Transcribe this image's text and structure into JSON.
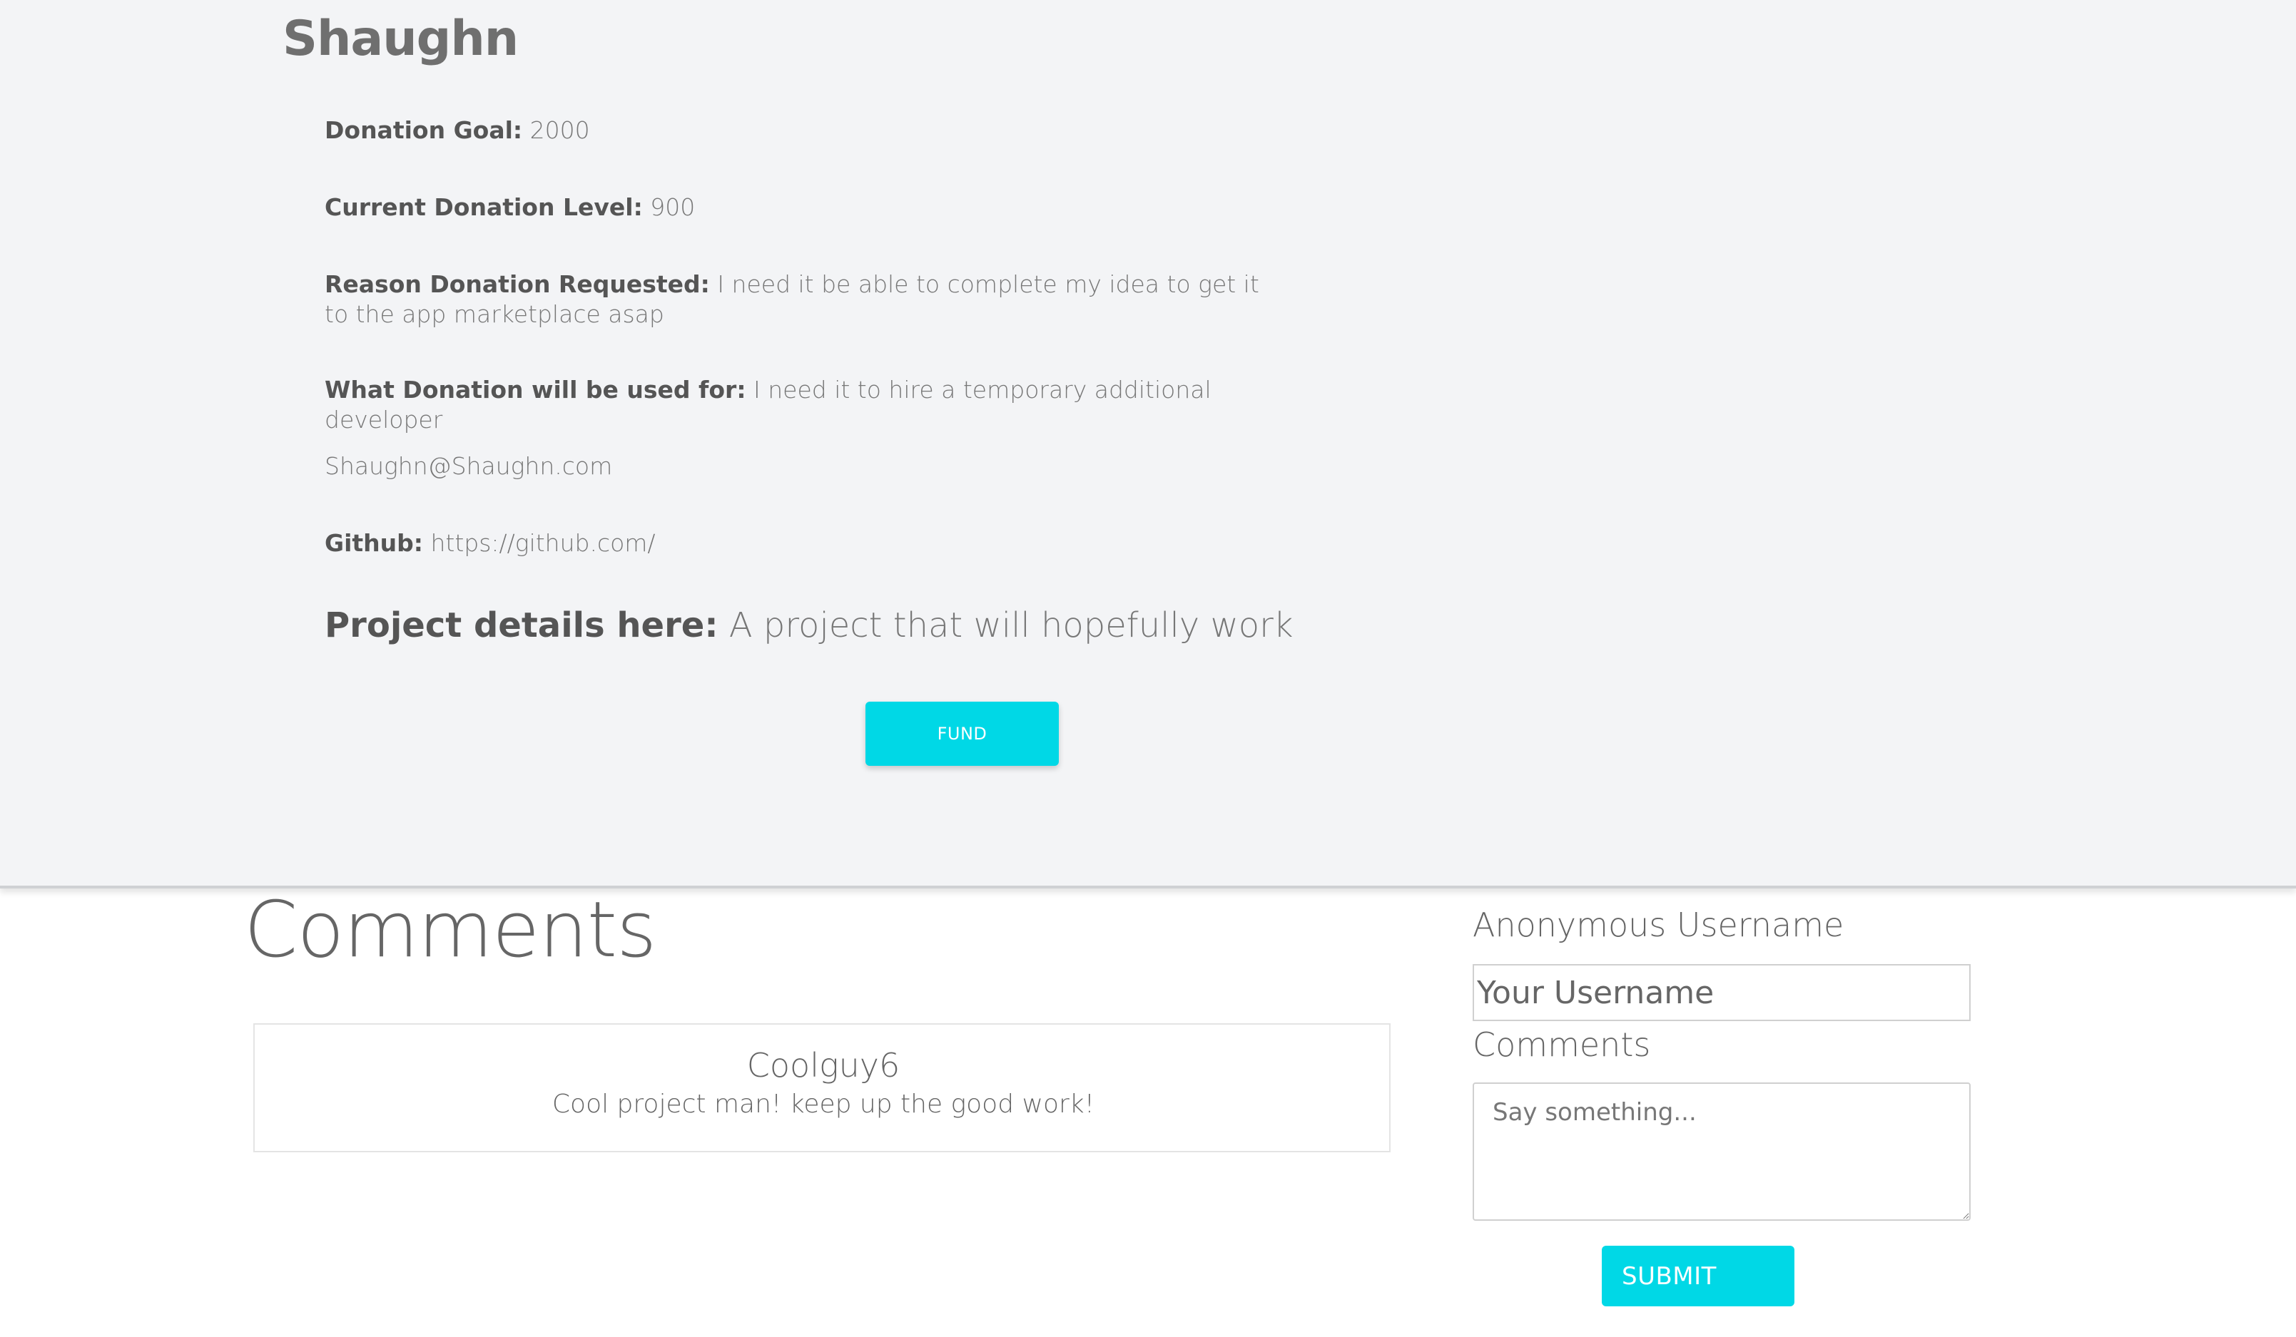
{
  "project": {
    "title": "Shaughn",
    "donation_goal": {
      "label": "Donation Goal:",
      "value": "2000"
    },
    "current_donation_level": {
      "label": "Current Donation Level:",
      "value": "900"
    },
    "reason": {
      "label": "Reason Donation Requested:",
      "value": "I need it be able to complete my idea to get it to the app marketplace asap"
    },
    "used_for": {
      "label": "What Donation will be used for:",
      "value": "I need it to hire a temporary additional developer"
    },
    "email": "Shaughn@Shaughn.com",
    "github": {
      "label": "Github:",
      "value": "https://github.com/"
    },
    "details": {
      "label": "Project details here:",
      "value": "A project that will hopefully work"
    },
    "fund_button_label": "FUND"
  },
  "comments": {
    "heading": "Comments",
    "items": [
      {
        "author": "Coolguy6",
        "text": "Cool project man! keep up the good work!"
      }
    ]
  },
  "form": {
    "username_label": "Anonymous Username",
    "username_placeholder": "Your Username",
    "comments_label": "Comments",
    "comments_placeholder": "Say something...",
    "submit_label": "SUBMIT"
  },
  "colors": {
    "accent": "#00d8e6",
    "panel_background": "#f3f4f6",
    "text": "#666666"
  }
}
